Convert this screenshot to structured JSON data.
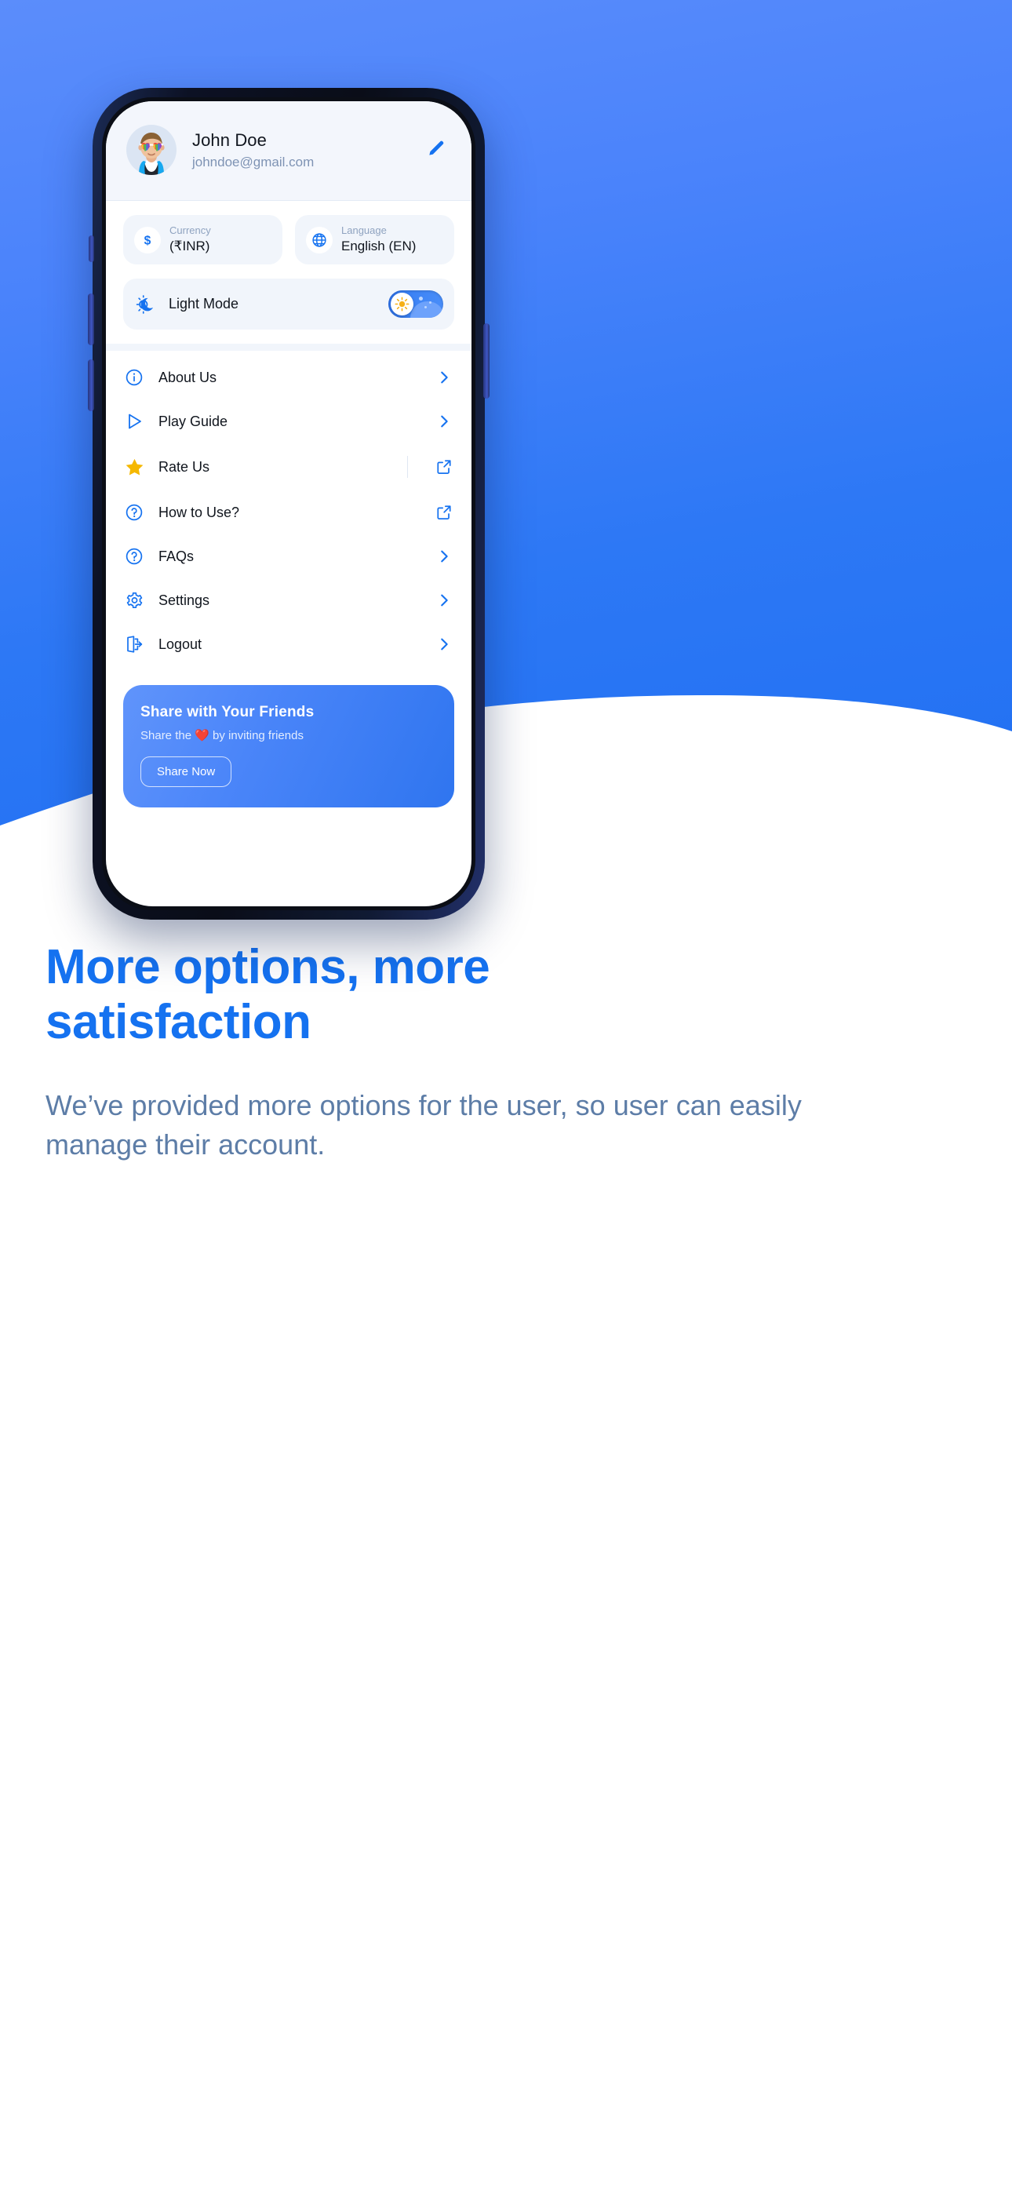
{
  "hero": {
    "background_color": "#3d80f7"
  },
  "phone": {
    "profile": {
      "avatar_icon": "avatar-boy-sunglasses",
      "name": "John Doe",
      "email": "johndoe@gmail.com",
      "edit_icon": "pencil-edit-icon"
    },
    "selectors": [
      {
        "icon": "dollar-icon",
        "label": "Currency",
        "value": "(₹INR)"
      },
      {
        "icon": "globe-icon",
        "label": "Language",
        "value": "English (EN)"
      }
    ],
    "theme_row": {
      "icon": "sun-moon-icon",
      "label": "Light Mode",
      "toggle": {
        "state": "on",
        "knob_icon": "sun-icon"
      }
    },
    "menu": [
      {
        "icon": "info-circle-icon",
        "label": "About Us",
        "action_icon": "chevron-right-icon",
        "divider": false
      },
      {
        "icon": "play-triangle-icon",
        "label": "Play Guide",
        "action_icon": "chevron-right-icon",
        "divider": false
      },
      {
        "icon": "star-icon",
        "label": "Rate Us",
        "action_icon": "external-link-icon",
        "divider": true
      },
      {
        "icon": "question-circle-icon",
        "label": "How to Use?",
        "action_icon": "external-link-icon",
        "divider": false
      },
      {
        "icon": "question-circle-icon",
        "label": "FAQs",
        "action_icon": "chevron-right-icon",
        "divider": false
      },
      {
        "icon": "gear-icon",
        "label": "Settings",
        "action_icon": "chevron-right-icon",
        "divider": false
      },
      {
        "icon": "logout-icon",
        "label": "Logout",
        "action_icon": "chevron-right-icon",
        "divider": false
      }
    ],
    "share_card": {
      "title": "Share with Your Friends",
      "subtitle": "Share the ❤️ by inviting friends",
      "button_label": "Share Now"
    }
  },
  "bottom": {
    "headline": "More options, more satisfaction",
    "subcopy": "We’ve provided more options for the user, so user can easily manage their account."
  }
}
